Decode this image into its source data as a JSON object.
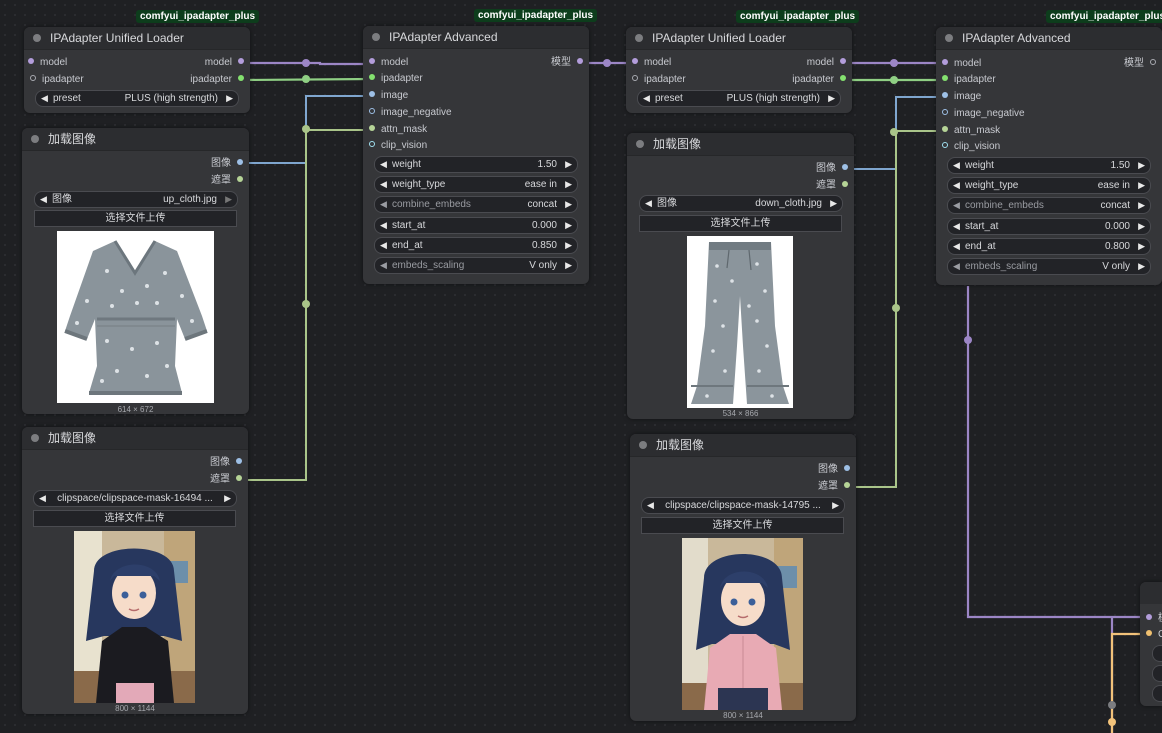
{
  "badges": [
    "comfyui_ipadapter_plus",
    "comfyui_ipadapter_plus",
    "comfyui_ipadapter_plus",
    "comfyui_ipadapter_plus"
  ],
  "loader1": {
    "title": "IPAdapter Unified Loader",
    "inputs": [
      "model",
      "ipadapter"
    ],
    "outputs": [
      "model",
      "ipadapter"
    ],
    "preset_label": "preset",
    "preset_value": "PLUS (high strength)"
  },
  "loader2": {
    "title": "IPAdapter Unified Loader",
    "inputs": [
      "model",
      "ipadapter"
    ],
    "outputs": [
      "model",
      "ipadapter"
    ],
    "preset_label": "preset",
    "preset_value": "PLUS (high strength)"
  },
  "adv1": {
    "title": "IPAdapter Advanced",
    "inputs": [
      "model",
      "ipadapter",
      "image",
      "image_negative",
      "attn_mask",
      "clip_vision"
    ],
    "output": "模型",
    "widgets": [
      {
        "label": "weight",
        "value": "1.50"
      },
      {
        "label": "weight_type",
        "value": "ease in"
      },
      {
        "label": "combine_embeds",
        "value": "concat"
      },
      {
        "label": "start_at",
        "value": "0.000"
      },
      {
        "label": "end_at",
        "value": "0.850"
      },
      {
        "label": "embeds_scaling",
        "value": "V only"
      }
    ]
  },
  "adv2": {
    "title": "IPAdapter Advanced",
    "inputs": [
      "model",
      "ipadapter",
      "image",
      "image_negative",
      "attn_mask",
      "clip_vision"
    ],
    "output": "模型",
    "widgets": [
      {
        "label": "weight",
        "value": "1.50"
      },
      {
        "label": "weight_type",
        "value": "ease in"
      },
      {
        "label": "combine_embeds",
        "value": "concat"
      },
      {
        "label": "start_at",
        "value": "0.000"
      },
      {
        "label": "end_at",
        "value": "0.800"
      },
      {
        "label": "embeds_scaling",
        "value": "V only"
      }
    ]
  },
  "load1": {
    "title": "加载图像",
    "outputs": [
      "图像",
      "遮罩"
    ],
    "image_label": "图像",
    "image_value": "up_cloth.jpg",
    "upload": "选择文件上传",
    "dims": "614 × 672"
  },
  "load2": {
    "title": "加载图像",
    "outputs": [
      "图像",
      "遮罩"
    ],
    "image_value": "clipspace/clipspace-mask-16494 ...",
    "upload": "选择文件上传",
    "dims": "800 × 1144"
  },
  "load3": {
    "title": "加载图像",
    "outputs": [
      "图像",
      "遮罩"
    ],
    "image_label": "图像",
    "image_value": "down_cloth.jpg",
    "upload": "选择文件上传",
    "dims": "534 × 866"
  },
  "load4": {
    "title": "加载图像",
    "outputs": [
      "图像",
      "遮罩"
    ],
    "image_value": "clipspace/clipspace-mask-14795 ...",
    "upload": "选择文件上传",
    "dims": "800 × 1144"
  },
  "partial": {
    "inputs": [
      "模",
      "C"
    ]
  },
  "colors": {
    "model_wire": "#9c86c6",
    "ipadapter_wire": "#8fcf84",
    "image_wire": "#7fa6cf",
    "mask_wire": "#a9c489",
    "orange_wire": "#f2c27a"
  },
  "icons": [
    "triangle-left-icon",
    "triangle-right-icon",
    "node-collapse-dot-icon"
  ]
}
